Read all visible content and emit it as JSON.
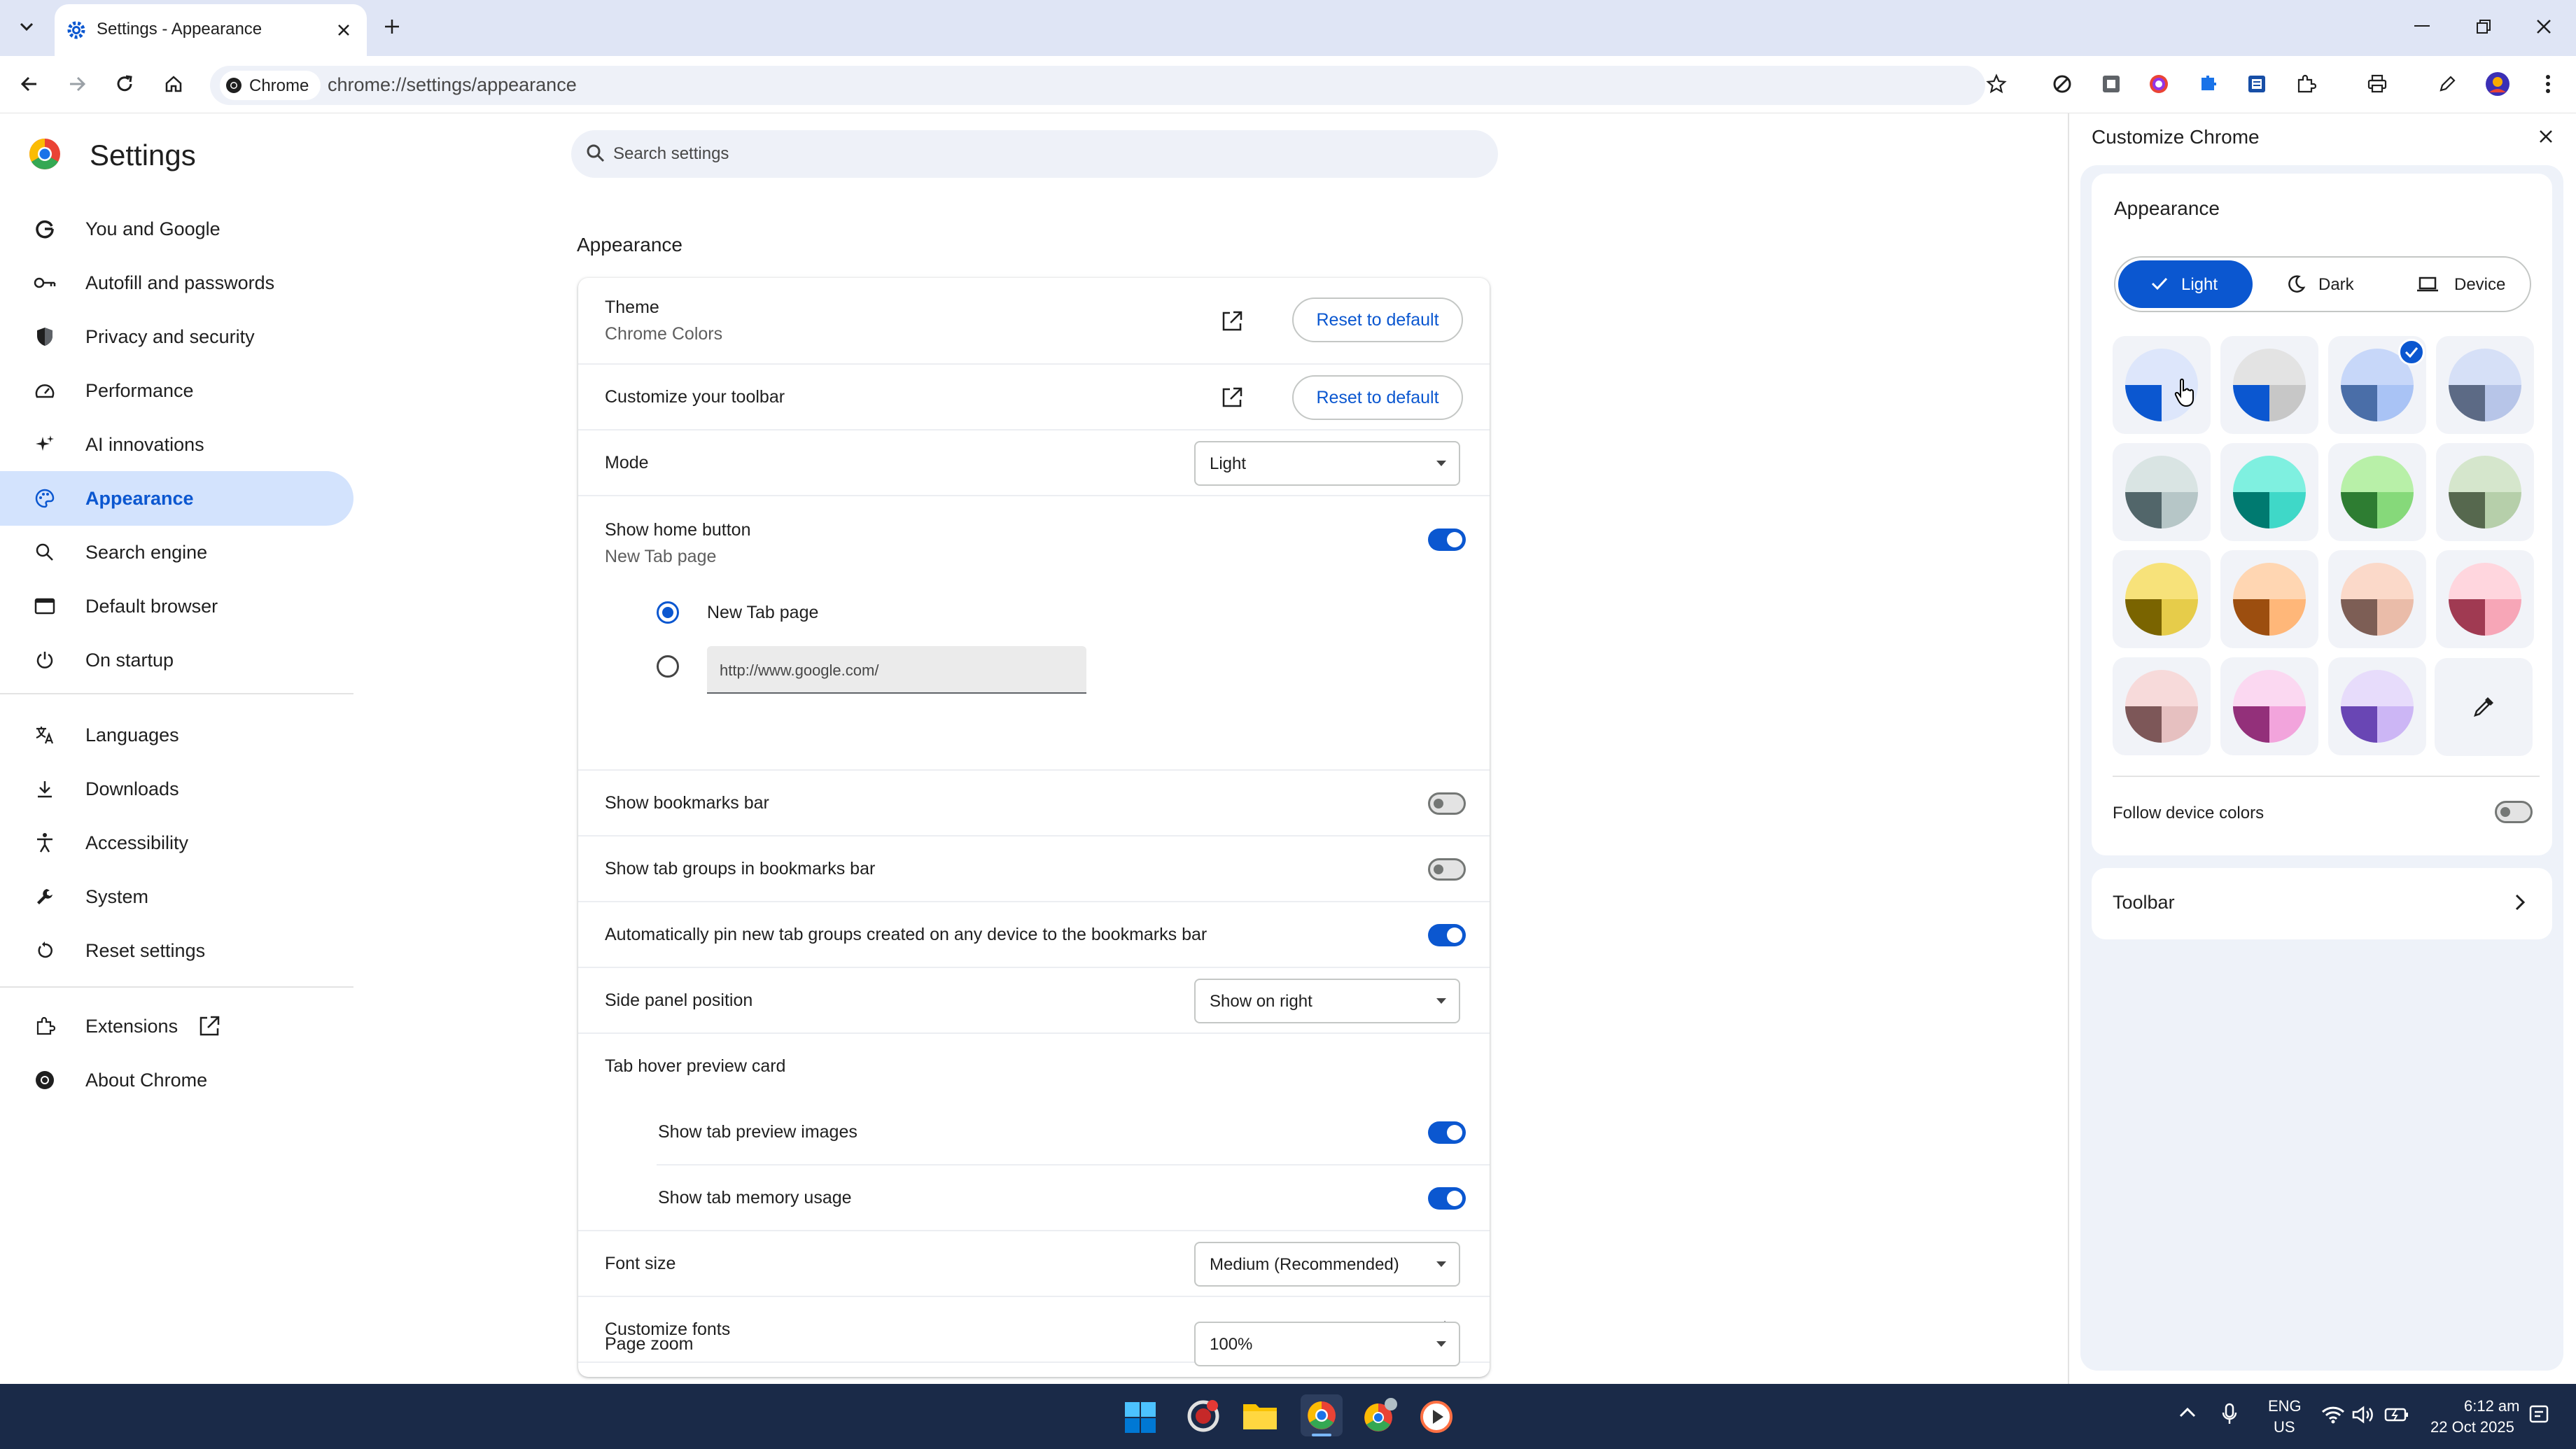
{
  "browser": {
    "tab_title": "Settings - Appearance",
    "chip_label": "Chrome",
    "url": "chrome://settings/appearance"
  },
  "settings": {
    "title": "Settings",
    "search_placeholder": "Search settings",
    "nav": [
      {
        "label": "You and Google",
        "icon": "google-icon"
      },
      {
        "label": "Autofill and passwords",
        "icon": "key-icon"
      },
      {
        "label": "Privacy and security",
        "icon": "shield-icon"
      },
      {
        "label": "Performance",
        "icon": "speedometer-icon"
      },
      {
        "label": "AI innovations",
        "icon": "sparkle-icon"
      },
      {
        "label": "Appearance",
        "icon": "palette-icon"
      },
      {
        "label": "Search engine",
        "icon": "search-icon"
      },
      {
        "label": "Default browser",
        "icon": "browser-window-icon"
      },
      {
        "label": "On startup",
        "icon": "power-icon"
      },
      {
        "label": "Languages",
        "icon": "translate-icon"
      },
      {
        "label": "Downloads",
        "icon": "download-icon"
      },
      {
        "label": "Accessibility",
        "icon": "accessibility-icon"
      },
      {
        "label": "System",
        "icon": "wrench-icon"
      },
      {
        "label": "Reset settings",
        "icon": "reset-icon"
      },
      {
        "label": "Extensions",
        "icon": "puzzle-icon"
      },
      {
        "label": "About Chrome",
        "icon": "chrome-icon"
      }
    ]
  },
  "appearance": {
    "section_title": "Appearance",
    "theme_label": "Theme",
    "theme_value": "Chrome Colors",
    "reset_label": "Reset to default",
    "customize_toolbar_label": "Customize your toolbar",
    "mode_label": "Mode",
    "mode_value": "Light",
    "home_button_label": "Show home button",
    "home_button_sub": "New Tab page",
    "home_button_on": true,
    "radio_newtab_label": "New Tab page",
    "radio_url_value": "http://www.google.com/",
    "bookmarks_bar_label": "Show bookmarks bar",
    "tab_groups_label": "Show tab groups in bookmarks bar",
    "auto_pin_label": "Automatically pin new tab groups created on any device to the bookmarks bar",
    "side_panel_label": "Side panel position",
    "side_panel_value": "Show on right",
    "hover_card_label": "Tab hover preview card",
    "preview_images_label": "Show tab preview images",
    "memory_usage_label": "Show tab memory usage",
    "font_size_label": "Font size",
    "font_size_value": "Medium (Recommended)",
    "customize_fonts_label": "Customize fonts",
    "page_zoom_label": "Page zoom",
    "page_zoom_value": "100%"
  },
  "customize_panel": {
    "title": "Customize Chrome",
    "appearance_heading": "Appearance",
    "modes": [
      "Light",
      "Dark",
      "Device"
    ],
    "selected_mode": "Light",
    "swatches": [
      {
        "top": "#dde6fb",
        "left": "#0b57d0",
        "right": "#dde6fb"
      },
      {
        "top": "#e3e3e3",
        "left": "#0b57d0",
        "right": "#c7c7c7"
      },
      {
        "top": "#c7d7f9",
        "left": "#4a6ea8",
        "right": "#a9c3f5"
      },
      {
        "top": "#d6e0f7",
        "left": "#5c6a85",
        "right": "#b7c5e8"
      },
      {
        "top": "#d9e4e3",
        "left": "#52666a",
        "right": "#b6c6c7"
      },
      {
        "top": "#7ff0e0",
        "left": "#007a70",
        "right": "#3fd8c8"
      },
      {
        "top": "#b8f0a8",
        "left": "#2e7d32",
        "right": "#86d97a"
      },
      {
        "top": "#d5e6cc",
        "left": "#56684e",
        "right": "#b6cfaa"
      },
      {
        "top": "#f7e27a",
        "left": "#7a6400",
        "right": "#e6cc4a"
      },
      {
        "top": "#ffd6b2",
        "left": "#9c4e0f",
        "right": "#ffb779"
      },
      {
        "top": "#fbd9c9",
        "left": "#7d5e55",
        "right": "#eabca9"
      },
      {
        "top": "#ffd6de",
        "left": "#a03a52",
        "right": "#f7a6b7"
      },
      {
        "top": "#f7dada",
        "left": "#7d5758",
        "right": "#e6c0c0"
      },
      {
        "top": "#fbd8f1",
        "left": "#93307a",
        "right": "#f2a4dc"
      },
      {
        "top": "#e7dcfb",
        "left": "#6946b4",
        "right": "#ccb6f5"
      }
    ],
    "selected_swatch_index": 2,
    "follow_device_label": "Follow device colors",
    "toolbar_label": "Toolbar"
  },
  "taskbar": {
    "lang": "ENG",
    "region": "US",
    "time": "6:12 am",
    "date": "22 Oct 2025"
  },
  "colors": {
    "accent": "#0b57d0",
    "nav_active_bg": "#d3e3fd",
    "titlebar": "#dfe5f5",
    "taskbar": "#1a2a48"
  }
}
